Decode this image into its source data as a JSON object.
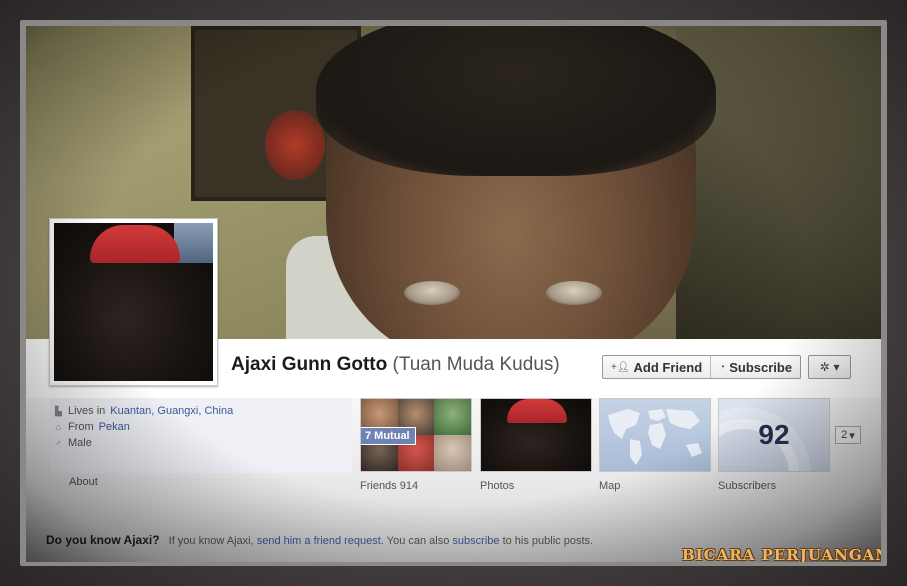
{
  "profile": {
    "name": "Ajaxi Gunn Gotto",
    "alt_name": "(Tuan Muda Kudus)"
  },
  "actions": {
    "add_friend_label": "Add Friend",
    "subscribe_label": "Subscribe"
  },
  "info": {
    "lives_prefix": "Lives in",
    "lives_link": "Kuantan, Guangxi, China",
    "from_prefix": "From",
    "from_link": "Pekan",
    "gender": "Male",
    "about_label": "About"
  },
  "tiles": {
    "friends_label": "Friends",
    "friends_count": "914",
    "mutual_badge": "7 Mutual",
    "photos_label": "Photos",
    "map_label": "Map",
    "subscribers_label": "Subscribers",
    "subscribers_count": "92",
    "more_count": "2"
  },
  "prompt": {
    "title": "Do you know Ajaxi?",
    "text_1": "If you know Ajaxi,",
    "link_1": "send him a friend request",
    "text_2": ". You can also",
    "link_2": "subscribe",
    "text_3": "to his public posts."
  },
  "watermark": "BICARA PERJUANGAN",
  "colors": {
    "link": "#3b5998",
    "badge": "#6d84b4"
  }
}
